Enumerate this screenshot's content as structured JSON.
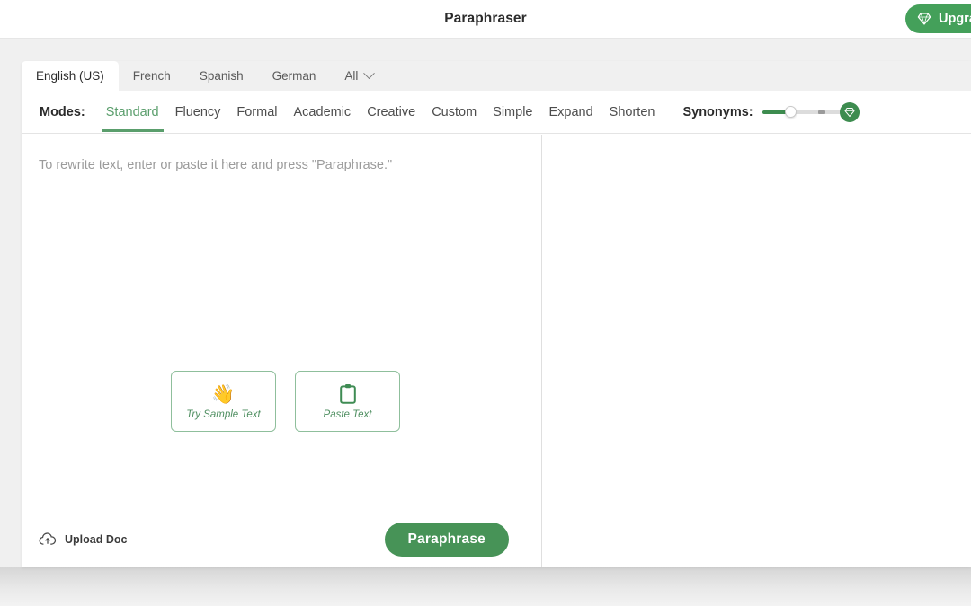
{
  "header": {
    "title": "Paraphraser",
    "upgrade_label": "Upgrade",
    "upgrade_icon": "diamond-icon"
  },
  "language_tabs": {
    "items": [
      {
        "label": "English (US)",
        "active": true
      },
      {
        "label": "French",
        "active": false
      },
      {
        "label": "Spanish",
        "active": false
      },
      {
        "label": "German",
        "active": false
      },
      {
        "label": "All",
        "active": false,
        "icon": "chevron-down-icon"
      }
    ]
  },
  "modes": {
    "label": "Modes:",
    "items": [
      {
        "label": "Standard",
        "active": true
      },
      {
        "label": "Fluency",
        "active": false
      },
      {
        "label": "Formal",
        "active": false
      },
      {
        "label": "Academic",
        "active": false
      },
      {
        "label": "Creative",
        "active": false
      },
      {
        "label": "Custom",
        "active": false
      },
      {
        "label": "Simple",
        "active": false
      },
      {
        "label": "Expand",
        "active": false
      },
      {
        "label": "Shorten",
        "active": false
      }
    ],
    "active_mode": "Standard"
  },
  "synonyms": {
    "label": "Synonyms:",
    "value": 25,
    "min": 0,
    "max": 100,
    "end_icon": "diamond-icon"
  },
  "editor": {
    "placeholder": "To rewrite text, enter or paste it here and press \"Paraphrase.\"",
    "value": "",
    "actions": [
      {
        "label": "Try Sample Text",
        "icon": "waving-hand-icon",
        "glyph": "👋"
      },
      {
        "label": "Paste Text",
        "icon": "clipboard-icon"
      }
    ]
  },
  "output": {
    "value": ""
  },
  "toolbar": {
    "upload_label": "Upload Doc",
    "upload_icon": "cloud-upload-icon",
    "paraphrase_label": "Paraphrase"
  },
  "colors": {
    "brand_green": "#479357",
    "accent_green": "#5a9e6c",
    "upgrade_green": "#44a05a",
    "page_bg": "#f0f0f0"
  }
}
